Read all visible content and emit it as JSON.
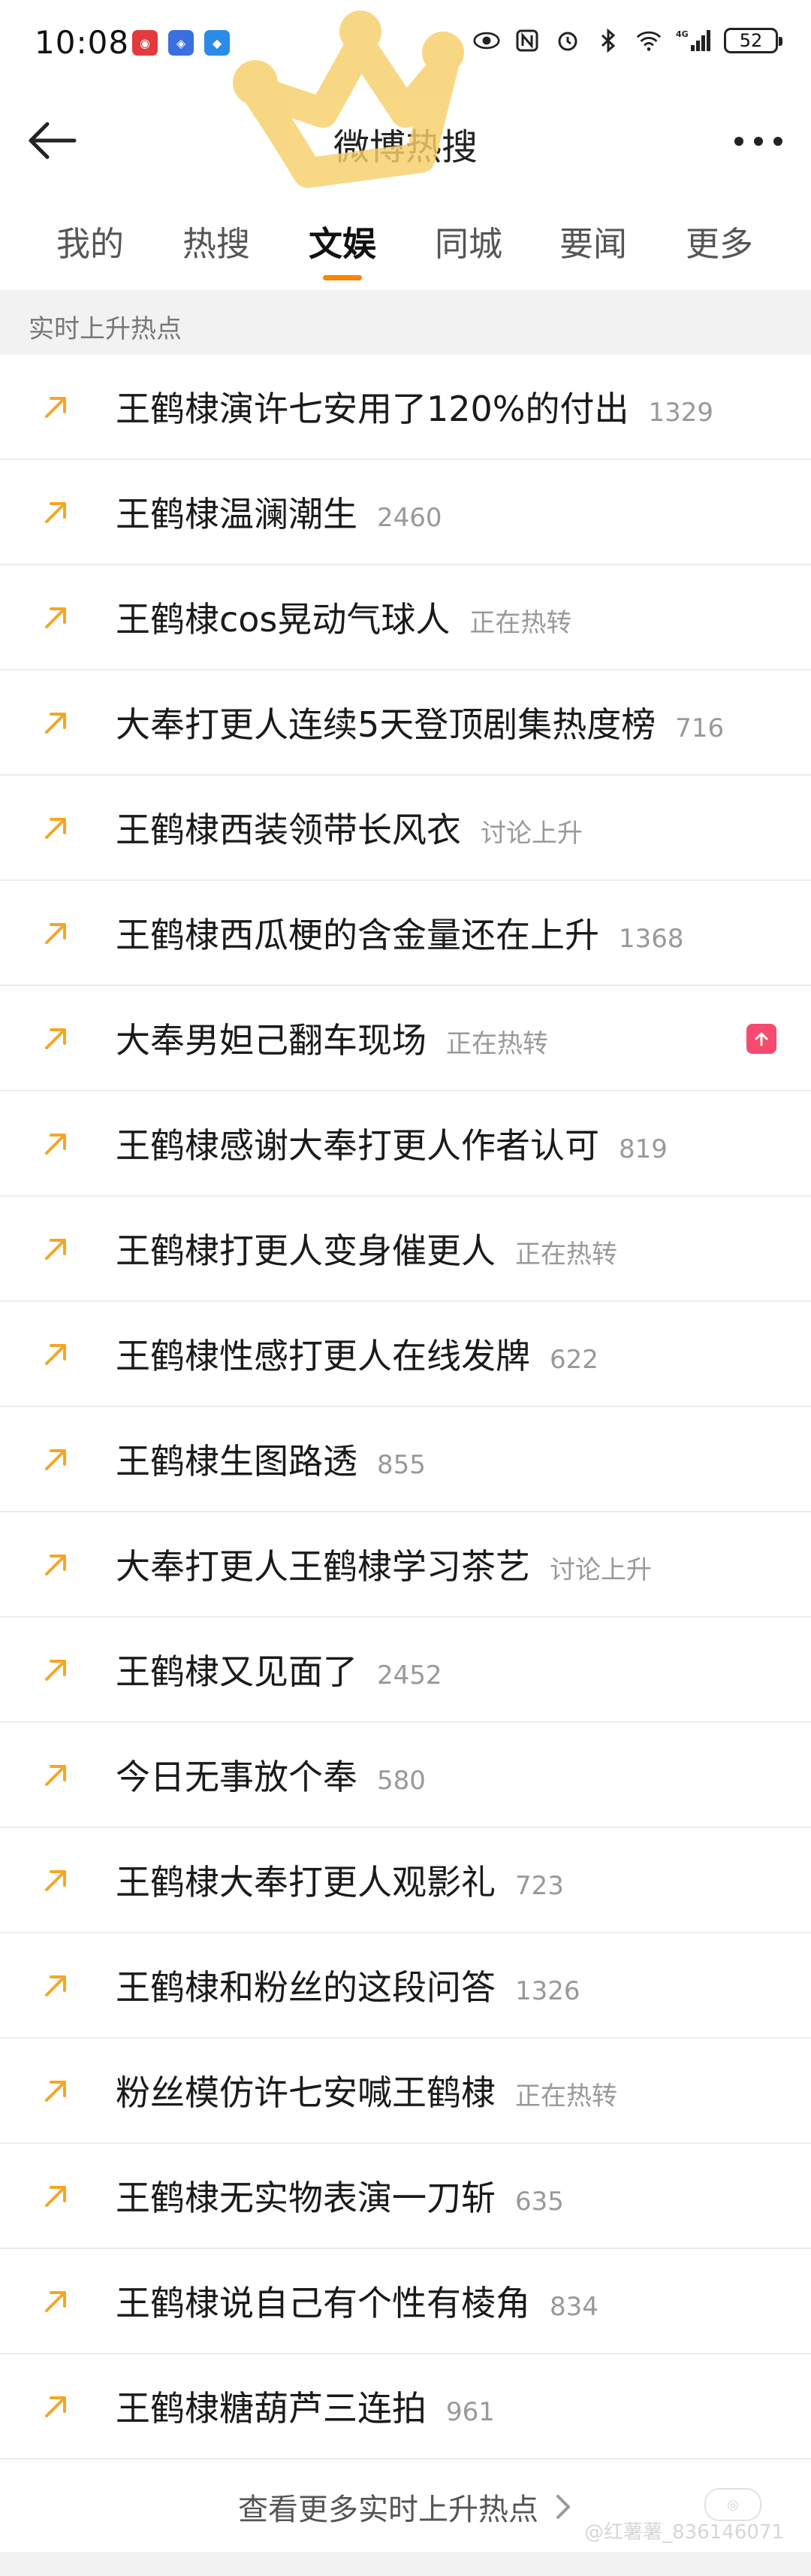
{
  "status_bar": {
    "time": "10:08",
    "battery": "52",
    "network": "4G"
  },
  "header": {
    "title": "微博热搜"
  },
  "tabs": [
    {
      "label": "我的"
    },
    {
      "label": "热搜"
    },
    {
      "label": "文娱",
      "active": true
    },
    {
      "label": "同城"
    },
    {
      "label": "要闻"
    },
    {
      "label": "更多"
    }
  ],
  "section": {
    "title": "实时上升热点"
  },
  "items": [
    {
      "title": "王鹤棣演许七安用了120%的付出",
      "meta": "1329"
    },
    {
      "title": "王鹤棣温澜潮生",
      "meta": "2460"
    },
    {
      "title": "王鹤棣cos晃动气球人",
      "meta": "正在热转"
    },
    {
      "title": "大奉打更人连续5天登顶剧集热度榜",
      "meta": "716"
    },
    {
      "title": "王鹤棣西装领带长风衣",
      "meta": "讨论上升"
    },
    {
      "title": "王鹤棣西瓜梗的含金量还在上升",
      "meta": "1368"
    },
    {
      "title": "大奉男妲己翻车现场",
      "meta": "正在热转",
      "badge": "rising-badge"
    },
    {
      "title": "王鹤棣感谢大奉打更人作者认可",
      "meta": "819"
    },
    {
      "title": "王鹤棣打更人变身催更人",
      "meta": "正在热转"
    },
    {
      "title": "王鹤棣性感打更人在线发牌",
      "meta": "622"
    },
    {
      "title": "王鹤棣生图路透",
      "meta": "855"
    },
    {
      "title": "大奉打更人王鹤棣学习茶艺",
      "meta": "讨论上升"
    },
    {
      "title": "王鹤棣又见面了",
      "meta": "2452"
    },
    {
      "title": "今日无事放个奉",
      "meta": "580"
    },
    {
      "title": "王鹤棣大奉打更人观影礼",
      "meta": "723"
    },
    {
      "title": "王鹤棣和粉丝的这段问答",
      "meta": "1326"
    },
    {
      "title": "粉丝模仿许七安喊王鹤棣",
      "meta": "正在热转"
    },
    {
      "title": "王鹤棣无实物表演一刀斩",
      "meta": "635"
    },
    {
      "title": "王鹤棣说自己有个性有棱角",
      "meta": "834"
    },
    {
      "title": "王鹤棣糖葫芦三连拍",
      "meta": "961"
    }
  ],
  "footer": {
    "view_more": "查看更多实时上升热点",
    "watermark": "@红薯薯_836146071"
  },
  "colors": {
    "accent": "#ff8200",
    "arrow": "#f5a623",
    "badge": "#f64a6e"
  }
}
